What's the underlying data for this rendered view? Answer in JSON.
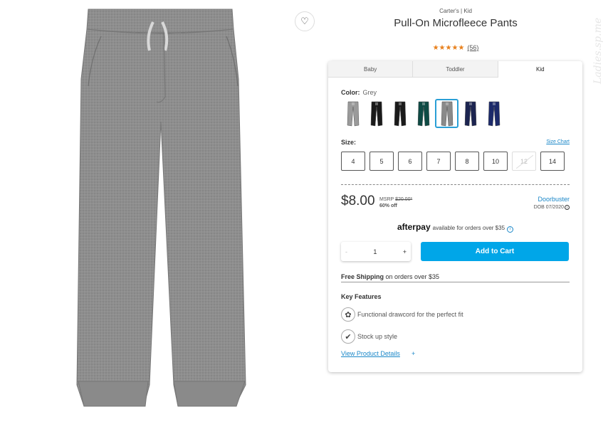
{
  "product": {
    "brand": "Carter's | Kid",
    "title": "Pull-On Microfleece Pants",
    "stars": "★★★★★",
    "rating_count": "(56)"
  },
  "watermark": "Ladies.sp.me",
  "tabs": [
    {
      "label": "Baby",
      "active": false
    },
    {
      "label": "Toddler",
      "active": false
    },
    {
      "label": "Kid",
      "active": true
    }
  ],
  "color": {
    "label": "Color:",
    "value": "Grey",
    "swatches": [
      {
        "color": "#9a9a9a",
        "selected": false
      },
      {
        "color": "#1a1a1a",
        "selected": false
      },
      {
        "color": "#1a1a1a",
        "selected": false
      },
      {
        "color": "#0e4a44",
        "selected": false
      },
      {
        "color": "#8a8a8a",
        "selected": true
      },
      {
        "color": "#1c2450",
        "selected": false
      },
      {
        "color": "#1c2a6a",
        "selected": false
      }
    ]
  },
  "size": {
    "label": "Size:",
    "chart_link": "Size Chart",
    "options": [
      {
        "label": "4",
        "disabled": false
      },
      {
        "label": "5",
        "disabled": false
      },
      {
        "label": "6",
        "disabled": false
      },
      {
        "label": "7",
        "disabled": false
      },
      {
        "label": "8",
        "disabled": false
      },
      {
        "label": "10",
        "disabled": false
      },
      {
        "label": "12",
        "disabled": true
      },
      {
        "label": "14",
        "disabled": false
      }
    ]
  },
  "pricing": {
    "price": "$8.00",
    "msrp_label": "MSRP",
    "msrp_value": "$20.00*",
    "discount": "60% off",
    "deal": "Doorbuster",
    "dob": "DOB 07/2020"
  },
  "afterpay": {
    "logo": "afterpay",
    "text": "available for orders over $35",
    "info_icon": "info-icon"
  },
  "cart": {
    "minus": "-",
    "quantity": "1",
    "plus": "+",
    "add_label": "Add to Cart"
  },
  "shipping": {
    "bold": "Free Shipping",
    "rest": " on orders over $35"
  },
  "features": {
    "title": "Key Features",
    "items": [
      {
        "icon": "drawcord-icon",
        "text": "Functional drawcord for the perfect fit"
      },
      {
        "icon": "checkmark-icon",
        "text": "Stock up style"
      }
    ],
    "details_link": "View Product Details",
    "details_plus": "+"
  },
  "colors": {
    "accent": "#00a6e8",
    "link": "#1a87c8",
    "stars": "#e8801c",
    "pants": "#8c8c8c"
  }
}
